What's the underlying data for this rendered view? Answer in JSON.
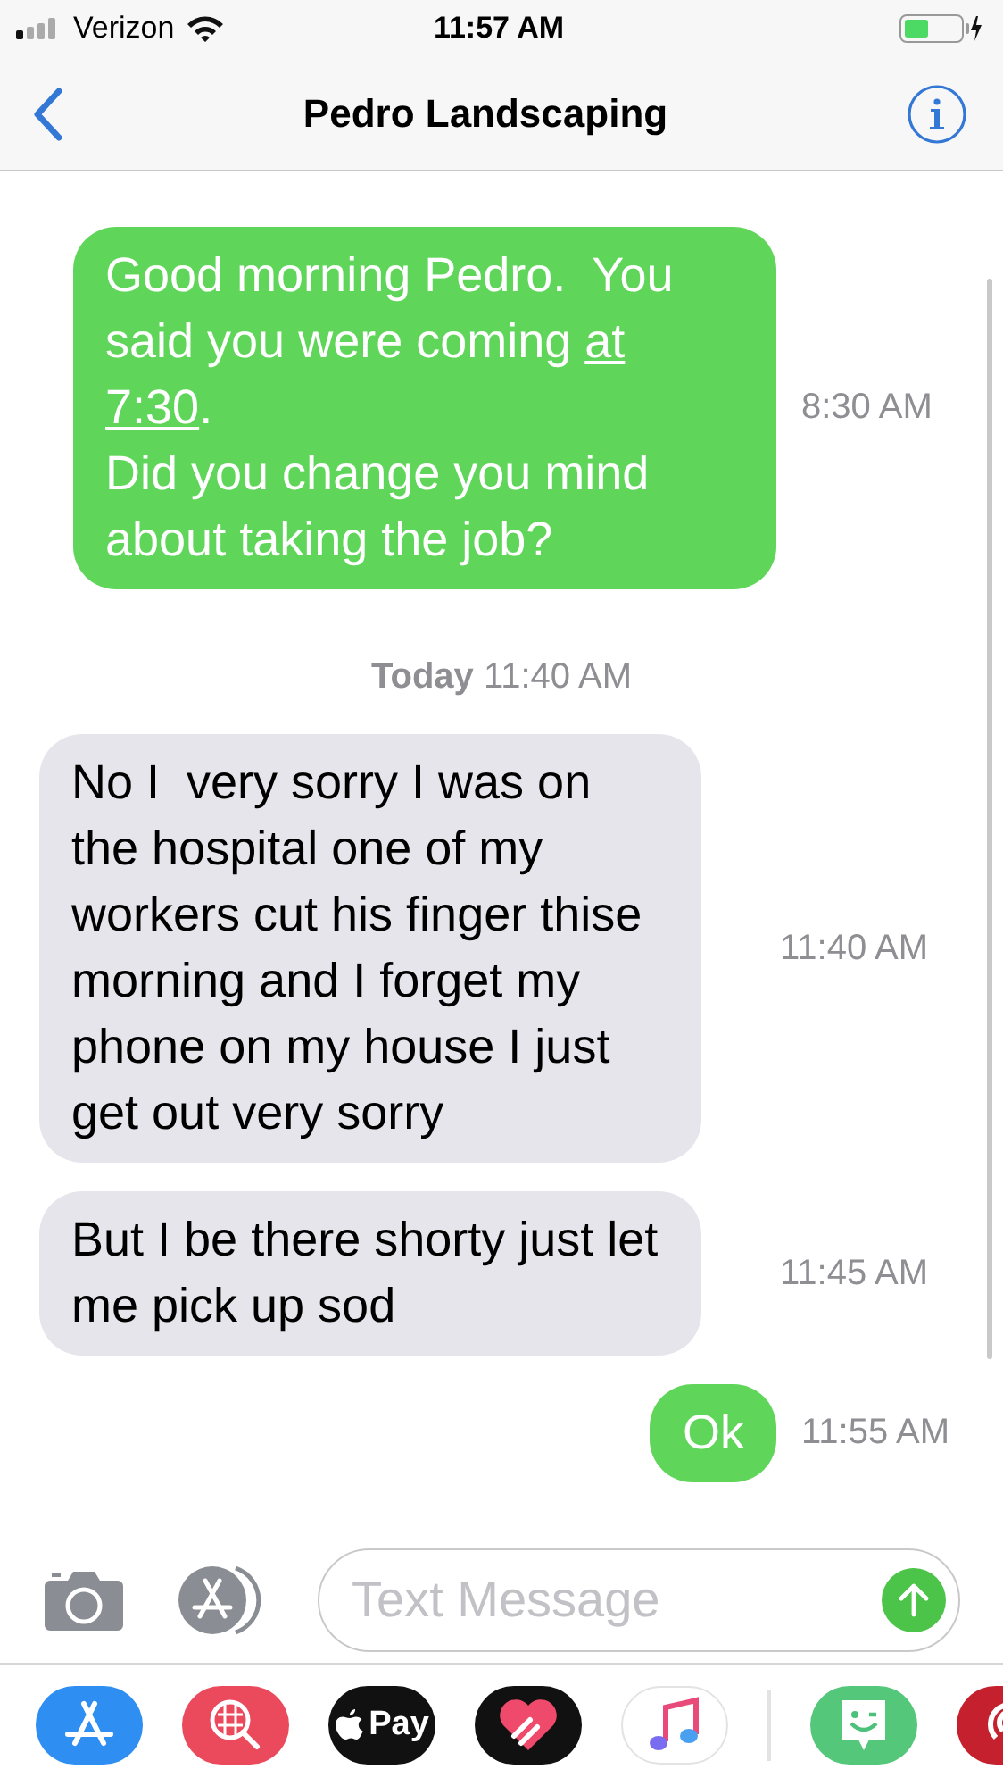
{
  "status_bar": {
    "carrier": "Verizon",
    "time": "11:57 AM"
  },
  "nav": {
    "title": "Pedro Landscaping"
  },
  "messages": [
    {
      "kind": "sent",
      "segments": [
        {
          "kind": "text",
          "text": "Good morning Pedro.  You said you were coming "
        },
        {
          "kind": "link",
          "text": "at"
        },
        {
          "kind": "link",
          "text": "7:30"
        },
        {
          "kind": "text",
          "text": ".\nDid you change you mind about taking the job?"
        }
      ],
      "time": "8:30 AM"
    },
    {
      "kind": "date",
      "label": "Today",
      "time": "11:40 AM"
    },
    {
      "kind": "received",
      "segments": [
        {
          "kind": "text",
          "text": "No I  very sorry I was on the hospital one of my workers cut his finger thise morning and I forget my phone on my house I just get out very sorry"
        }
      ],
      "time": "11:40 AM"
    },
    {
      "kind": "received",
      "segments": [
        {
          "kind": "text",
          "text": "But I be there shorty just let me pick up sod"
        }
      ],
      "time": "11:45 AM"
    },
    {
      "kind": "sent",
      "segments": [
        {
          "kind": "text",
          "text": "Ok"
        }
      ],
      "time": "11:55 AM"
    }
  ],
  "composer": {
    "placeholder": "Text Message"
  },
  "apps": [
    {
      "kind": "store"
    },
    {
      "kind": "search"
    },
    {
      "kind": "pay",
      "label": "Pay"
    },
    {
      "kind": "heart"
    },
    {
      "kind": "music"
    },
    {
      "kind": "divider"
    },
    {
      "kind": "face"
    },
    {
      "kind": "radio"
    }
  ]
}
